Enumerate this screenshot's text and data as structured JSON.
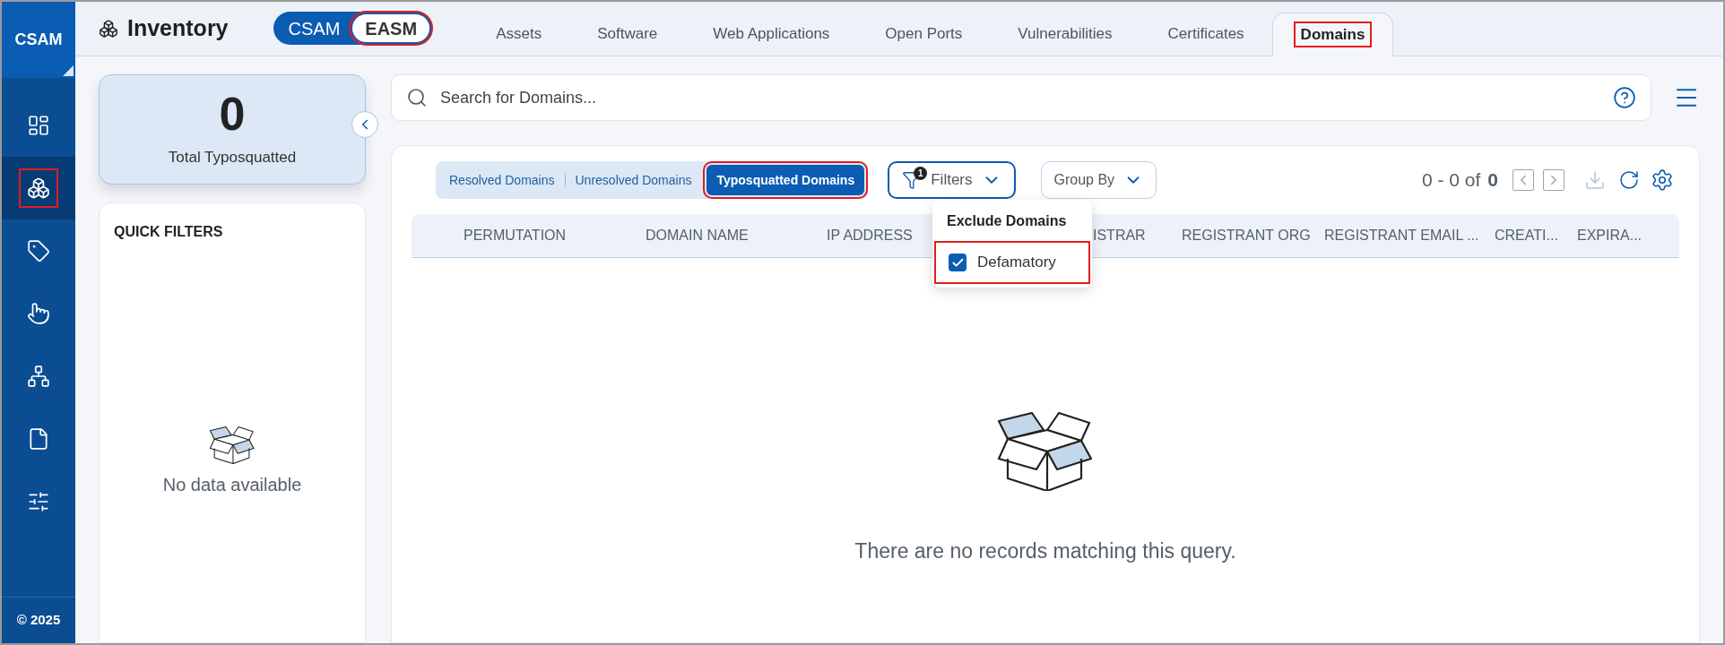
{
  "sidebar": {
    "brand": "CSAM",
    "items": [
      {
        "kind": "dashboard",
        "selected": false,
        "highlighted": false
      },
      {
        "kind": "inventory",
        "selected": true,
        "highlighted": true
      },
      {
        "kind": "tags",
        "selected": false,
        "highlighted": false
      },
      {
        "kind": "responses",
        "selected": false,
        "highlighted": false
      },
      {
        "kind": "hierarchy",
        "selected": false,
        "highlighted": false
      },
      {
        "kind": "reports",
        "selected": false,
        "highlighted": false
      },
      {
        "kind": "settings",
        "selected": false,
        "highlighted": false
      }
    ],
    "footer": "© 2025"
  },
  "header": {
    "title": "Inventory",
    "modes": [
      {
        "label": "CSAM",
        "selected": false,
        "highlighted": false
      },
      {
        "label": "EASM",
        "selected": true,
        "highlighted": true
      }
    ],
    "tabs": [
      {
        "label": "Assets",
        "selected": false,
        "highlighted": false
      },
      {
        "label": "Software",
        "selected": false,
        "highlighted": false
      },
      {
        "label": "Web Applications",
        "selected": false,
        "highlighted": false
      },
      {
        "label": "Open Ports",
        "selected": false,
        "highlighted": false
      },
      {
        "label": "Vulnerabilities",
        "selected": false,
        "highlighted": false
      },
      {
        "label": "Certificates",
        "selected": false,
        "highlighted": false
      },
      {
        "label": "Domains",
        "selected": true,
        "highlighted": true
      }
    ]
  },
  "stat_card": {
    "value": "0",
    "label": "Total Typosquatted"
  },
  "quick_filters": {
    "title": "QUICK FILTERS",
    "empty_text": "No data available"
  },
  "search": {
    "placeholder": "Search for Domains..."
  },
  "segments": [
    {
      "label": "Resolved Domains",
      "selected": false,
      "highlighted": false
    },
    {
      "label": "Unresolved Domains",
      "selected": false,
      "highlighted": false
    },
    {
      "label": "Typosquatted Domains",
      "selected": true,
      "highlighted": true
    }
  ],
  "filters_button": {
    "label": "Filters",
    "badge": "1"
  },
  "filter_menu": {
    "heading": "Exclude Domains",
    "options": [
      {
        "label": "Defamatory",
        "checked": true,
        "highlighted": true
      }
    ]
  },
  "group_by": {
    "label": "Group By"
  },
  "pagination": {
    "range": "0 - 0 of",
    "total": "0"
  },
  "table": {
    "columns": [
      "PERMUTATION",
      "DOMAIN NAME",
      "IP ADDRESS",
      "ISTRAR",
      "REGISTRANT ORG",
      "REGISTRANT EMAIL ...",
      "CREATI...",
      "EXPIRA..."
    ]
  },
  "empty_state": {
    "message": "There are no records matching this query."
  }
}
